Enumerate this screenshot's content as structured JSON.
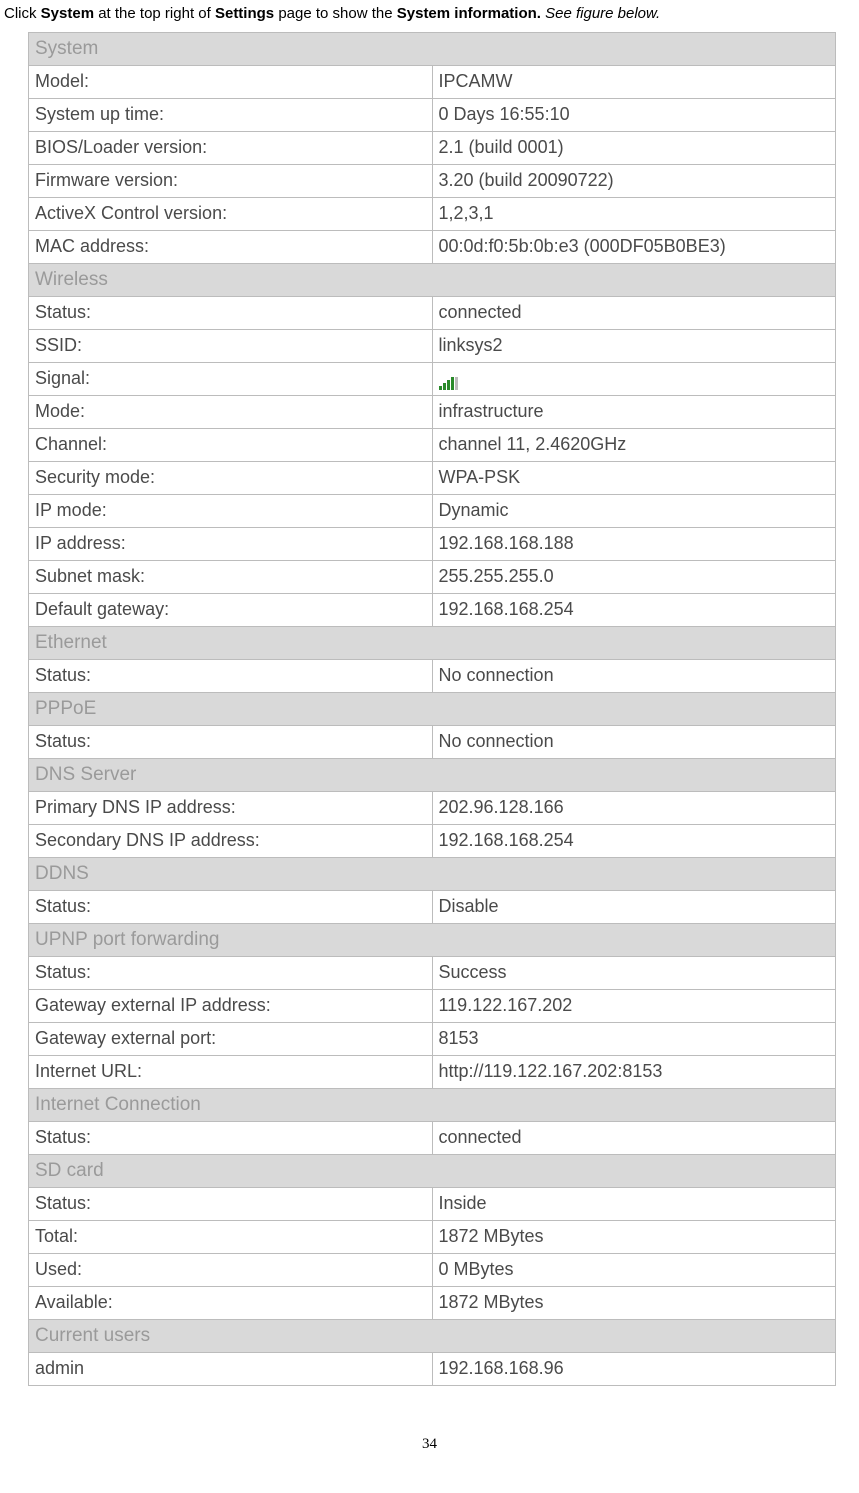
{
  "instruction": {
    "prefix": "Click ",
    "bold1": "System",
    "mid1": " at the top right of ",
    "bold2": "Settings",
    "mid2": " page to show the ",
    "bold3": "System information.",
    "italic": " See figure below."
  },
  "sections": [
    {
      "title": "System",
      "rows": [
        {
          "label": "Model:",
          "value": "IPCAMW"
        },
        {
          "label": "System up time:",
          "value": "0 Days 16:55:10"
        },
        {
          "label": "BIOS/Loader version:",
          "value": "2.1 (build 0001)"
        },
        {
          "label": "Firmware version:",
          "value": "3.20 (build 20090722)"
        },
        {
          "label": "ActiveX Control version:",
          "value": "1,2,3,1"
        },
        {
          "label": "MAC address:",
          "value": "00:0d:f0:5b:0b:e3 (000DF05B0BE3)"
        }
      ]
    },
    {
      "title": "Wireless",
      "rows": [
        {
          "label": "Status:",
          "value": "connected"
        },
        {
          "label": "SSID:",
          "value": "linksys2"
        },
        {
          "label": "Signal:",
          "value": "__SIGNAL_ICON__"
        },
        {
          "label": "Mode:",
          "value": "infrastructure"
        },
        {
          "label": "Channel:",
          "value": "channel 11, 2.4620GHz"
        },
        {
          "label": "Security mode:",
          "value": "WPA-PSK"
        },
        {
          "label": "IP mode:",
          "value": "Dynamic"
        },
        {
          "label": "IP address:",
          "value": "192.168.168.188"
        },
        {
          "label": "Subnet mask:",
          "value": "255.255.255.0"
        },
        {
          "label": "Default gateway:",
          "value": "192.168.168.254"
        }
      ]
    },
    {
      "title": "Ethernet",
      "rows": [
        {
          "label": "Status:",
          "value": "No connection"
        }
      ]
    },
    {
      "title": "PPPoE",
      "rows": [
        {
          "label": "Status:",
          "value": "No connection"
        }
      ]
    },
    {
      "title": "DNS Server",
      "rows": [
        {
          "label": "Primary DNS IP address:",
          "value": "202.96.128.166"
        },
        {
          "label": "Secondary DNS IP address:",
          "value": "192.168.168.254"
        }
      ]
    },
    {
      "title": "DDNS",
      "rows": [
        {
          "label": "Status:",
          "value": "Disable"
        }
      ]
    },
    {
      "title": "UPNP port forwarding",
      "rows": [
        {
          "label": "Status:",
          "value": "Success"
        },
        {
          "label": "Gateway external IP address:",
          "value": "119.122.167.202"
        },
        {
          "label": "Gateway external port:",
          "value": "8153"
        },
        {
          "label": "Internet URL:",
          "value": "http://119.122.167.202:8153"
        }
      ]
    },
    {
      "title": "Internet Connection",
      "rows": [
        {
          "label": "Status:",
          "value": "connected"
        }
      ]
    },
    {
      "title": "SD card",
      "rows": [
        {
          "label": "Status:",
          "value": "Inside"
        },
        {
          "label": "Total:",
          "value": "1872 MBytes"
        },
        {
          "label": "Used:",
          "value": "0 MBytes"
        },
        {
          "label": "Available:",
          "value": "1872 MBytes"
        }
      ]
    },
    {
      "title": "Current users",
      "rows": [
        {
          "label": "admin",
          "value": "192.168.168.96"
        }
      ]
    }
  ],
  "page_number": "34"
}
